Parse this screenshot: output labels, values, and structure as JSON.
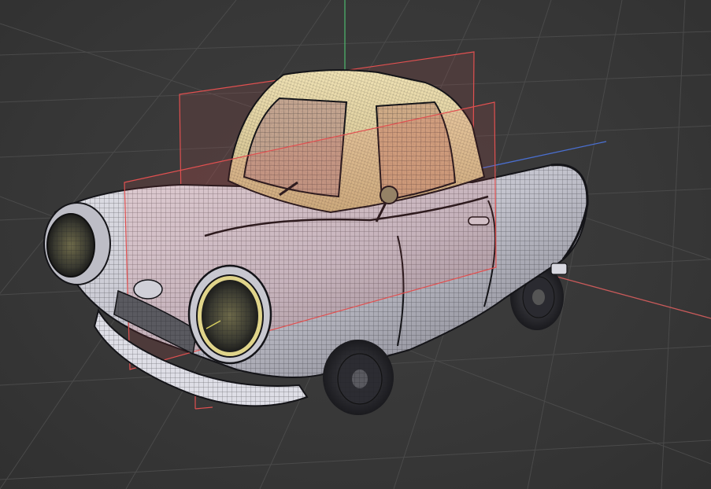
{
  "viewport": {
    "background_color": "#3a3a3a",
    "grid_color": "#4a4a4a",
    "axis_colors": {
      "x": "#c85a5a",
      "y": "#4caf6a",
      "z": "#4a6fd0"
    },
    "model": {
      "body_color": "#c8c8d0",
      "cabin_color": "#e6d6a4",
      "wire_color": "#1e1e22",
      "guide_plane_color": "#e05050"
    }
  }
}
